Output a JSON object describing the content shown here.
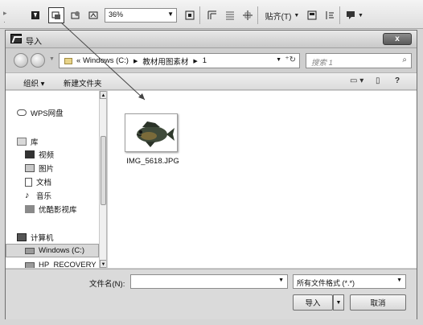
{
  "toolbar": {
    "zoom": "36%",
    "paste_label": "贴齐(T)"
  },
  "dialog": {
    "title": "导入",
    "close_glyph": "x",
    "address": {
      "prefix": "«",
      "crumbs": [
        "Windows (C:)",
        "教材用图素材",
        "1"
      ],
      "refresh_glyph": "⁺↻"
    },
    "search_placeholder": "搜索 1",
    "commands": {
      "organize": "组织 ▾",
      "new_folder": "新建文件夹"
    },
    "nav": {
      "items": [
        {
          "label": "WPS网盘",
          "icon": "cloud-icon"
        },
        {
          "label": "库",
          "icon": "library-icon"
        },
        {
          "label": "视频",
          "icon": "video-icon"
        },
        {
          "label": "图片",
          "icon": "picture-icon"
        },
        {
          "label": "文档",
          "icon": "document-icon"
        },
        {
          "label": "音乐",
          "icon": "music-icon"
        },
        {
          "label": "优酷影视库",
          "icon": "video-library-icon"
        },
        {
          "label": "计算机",
          "icon": "computer-icon"
        },
        {
          "label": "Windows (C:)",
          "icon": "drive-icon"
        },
        {
          "label": "HP_RECOVERY",
          "icon": "drive-icon"
        }
      ]
    },
    "files": [
      {
        "name": "IMG_5618.JPG"
      }
    ],
    "filename_label": "文件名(N):",
    "filename_value": "",
    "filetype": "所有文件格式 (*.*)",
    "import_button": "导入",
    "cancel_button": "取消"
  }
}
